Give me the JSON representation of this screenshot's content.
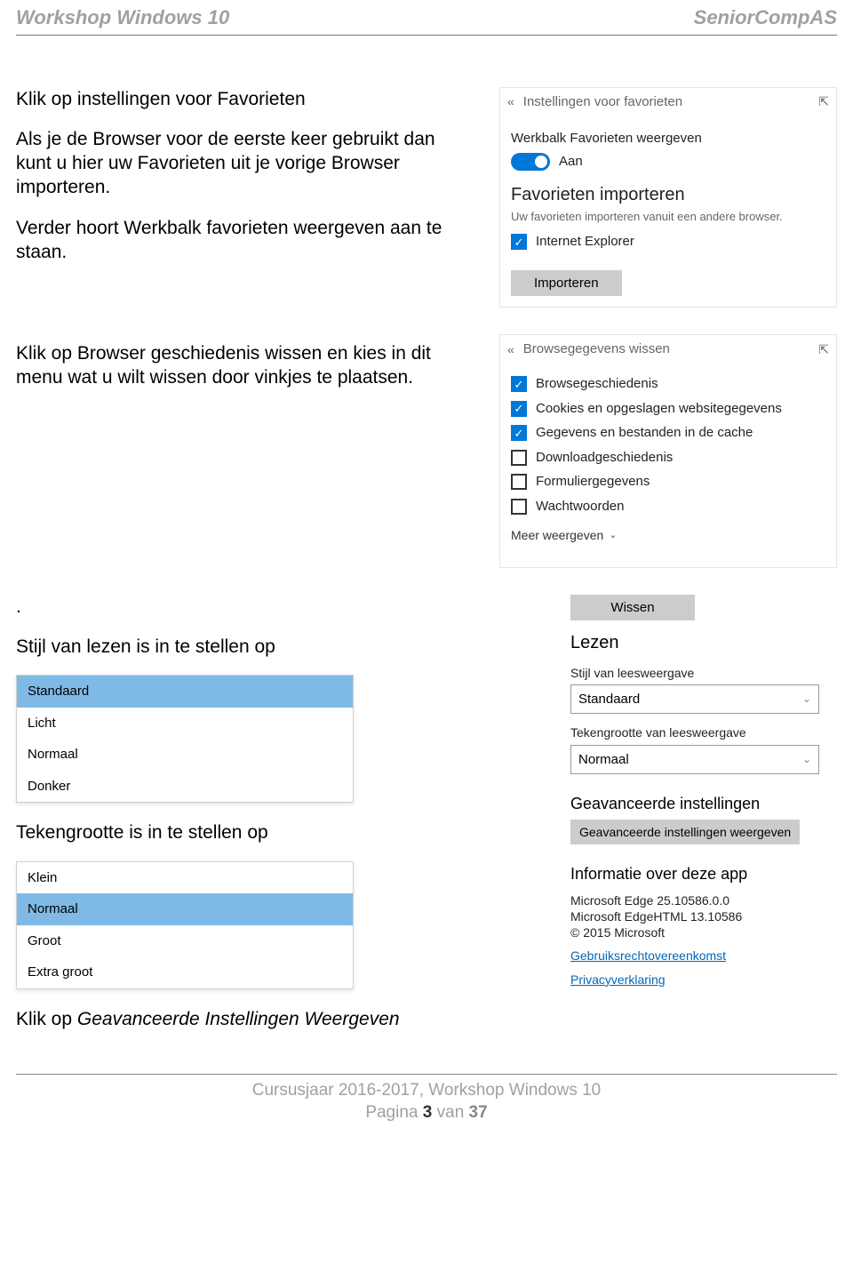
{
  "header": {
    "left": "Workshop Windows 10",
    "right": "SeniorCompAS"
  },
  "left": {
    "h1": "Klik op instellingen voor Favorieten",
    "p1": "Als je de Browser voor de eerste keer gebruikt dan kunt u hier uw Favorieten uit je vorige Browser importeren.",
    "p2": "Verder hoort Werkbalk favorieten weergeven aan te staan.",
    "h2": "Klik op Browser geschiedenis wissen en kies in dit menu wat u wilt wissen door vinkjes te plaatsen.",
    "dot": ".",
    "style_label": "Stijl van lezen is in te stellen op",
    "size_label": "Tekengrootte is in te stellen op",
    "h3": "Klik op Geavanceerde Instellingen Weergeven",
    "style_opts": [
      "Standaard",
      "Licht",
      "Normaal",
      "Donker"
    ],
    "style_selected_index": 0,
    "size_opts": [
      "Klein",
      "Normaal",
      "Groot",
      "Extra groot"
    ],
    "size_selected_index": 1
  },
  "fav_panel": {
    "title": "Instellingen voor favorieten",
    "toolbar_label": "Werkbalk Favorieten weergeven",
    "toggle_state": "Aan",
    "import_h": "Favorieten importeren",
    "import_sub": "Uw favorieten importeren vanuit een andere browser.",
    "ie_label": "Internet Explorer",
    "import_btn": "Importeren"
  },
  "clear_panel": {
    "title": "Browsegegevens wissen",
    "items": [
      {
        "label": "Browsegeschiedenis",
        "checked": true
      },
      {
        "label": "Cookies en opgeslagen websitegegevens",
        "checked": true
      },
      {
        "label": "Gegevens en bestanden in de cache",
        "checked": true
      },
      {
        "label": "Downloadgeschiedenis",
        "checked": false
      },
      {
        "label": "Formuliergegevens",
        "checked": false
      },
      {
        "label": "Wachtwoorden",
        "checked": false
      }
    ],
    "more": "Meer weergeven",
    "clear_btn": "Wissen"
  },
  "reading": {
    "h": "Lezen",
    "style_label": "Stijl van leesweergave",
    "style_value": "Standaard",
    "size_label": "Tekengrootte van leesweergave",
    "size_value": "Normaal"
  },
  "adv": {
    "h": "Geavanceerde instellingen",
    "btn": "Geavanceerde instellingen weergeven"
  },
  "about": {
    "h": "Informatie over deze app",
    "l1": "Microsoft Edge 25.10586.0.0",
    "l2": "Microsoft EdgeHTML 13.10586",
    "l3": "© 2015 Microsoft",
    "link1": "Gebruiksrechtovereenkomst",
    "link2": "Privacyverklaring"
  },
  "footer": {
    "line1": "Cursusjaar 2016-2017, Workshop Windows 10",
    "page_label_pre": "Pagina ",
    "page_num": "3",
    "page_label_mid": " van ",
    "page_total": "37"
  }
}
